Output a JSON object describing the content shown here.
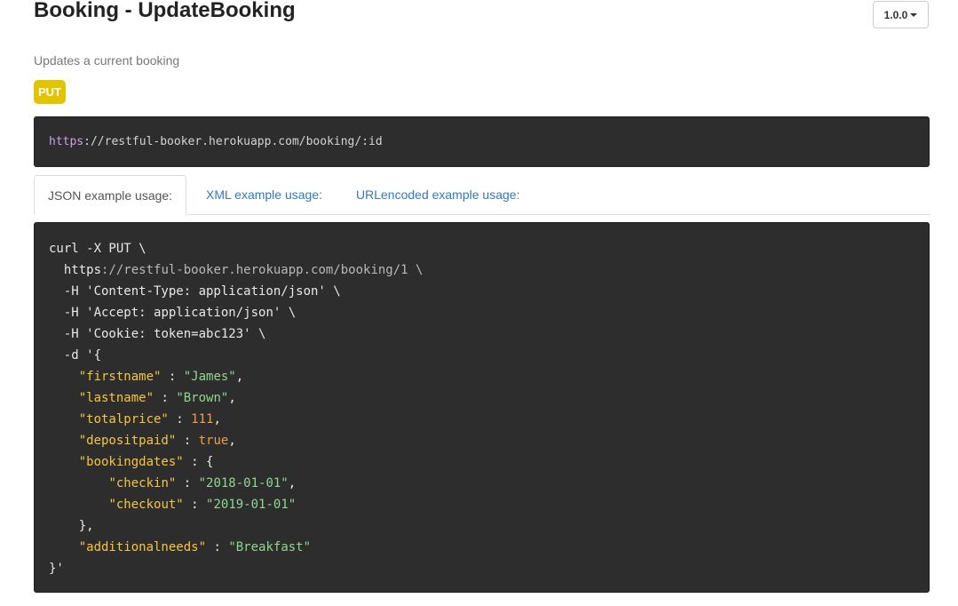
{
  "header": {
    "title": "Booking - UpdateBooking",
    "version_label": "1.0.0"
  },
  "description": "Updates a current booking",
  "method": {
    "label": "PUT",
    "color": "#e3c300"
  },
  "endpoint": {
    "scheme": "https",
    "rest": "://restful-booker.herokuapp.com/booking/:id"
  },
  "tabs": [
    {
      "label": "JSON example usage:",
      "active": true
    },
    {
      "label": "XML example usage:",
      "active": false
    },
    {
      "label": "URLencoded example usage:",
      "active": false
    }
  ],
  "code": {
    "line1": "curl -X PUT \\",
    "url_prefix": "  https",
    "url_rest": "://restful-booker.herokuapp.com/booking/1 \\",
    "header_ct_a": "  -H 'Content-Type",
    "header_ct_b": ": application/json' \\",
    "header_acc_a": "  -H 'Accept",
    "header_acc_b": ": application/json' \\",
    "header_cookie_a": "  -H 'Cookie",
    "header_cookie_b": ": token=abc123' \\",
    "data_open": "  -d '{",
    "firstname_key": "\"firstname\"",
    "firstname_val": "\"James\"",
    "lastname_key": "\"lastname\"",
    "lastname_val": "\"Brown\"",
    "totalprice_key": "\"totalprice\"",
    "totalprice_val": "111",
    "depositpaid_key": "\"depositpaid\"",
    "depositpaid_val": "true",
    "bookingdates_key": "\"bookingdates\"",
    "checkin_key": "\"checkin\"",
    "checkin_val": "\"2018-01-01\"",
    "checkout_key": "\"checkout\"",
    "checkout_val": "\"2019-01-01\"",
    "bookingdates_close": "    },",
    "additionalneeds_key": "\"additionalneeds\"",
    "additionalneeds_val": "\"Breakfast\"",
    "data_close": "}'"
  },
  "icons": {
    "version_caret": "caret-down-icon"
  },
  "colors": {
    "code_bg": "#2d2d2d",
    "json_key": "#f5c542",
    "json_string": "#8fd68f",
    "json_number": "#f29b4b",
    "link": "#337ab7"
  }
}
